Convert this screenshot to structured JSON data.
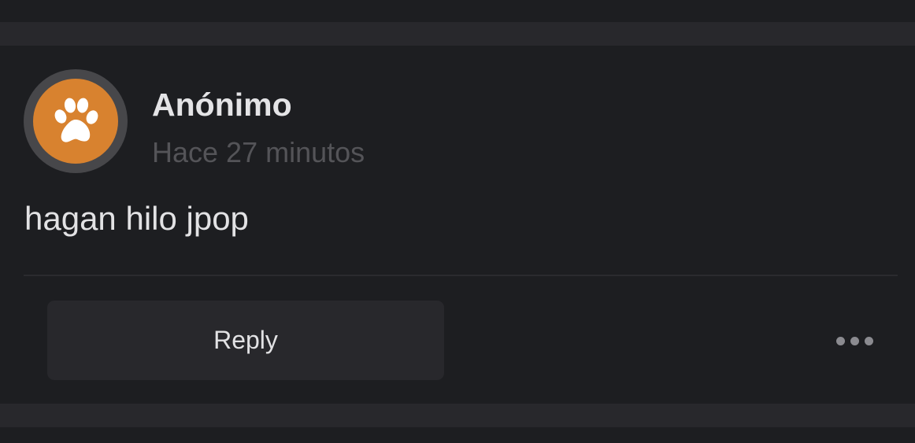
{
  "post": {
    "author": "Anónimo",
    "timestamp": "Hace 27 minutos",
    "body": "hagan hilo jpop",
    "avatar_icon": "paw-icon"
  },
  "actions": {
    "reply_label": "Reply",
    "more_icon": "more-horizontal-icon"
  },
  "colors": {
    "background": "#1d1e21",
    "separator": "#28282c",
    "avatar_ring": "#47474a",
    "avatar_fill": "#d8822f",
    "author_text": "#e4e4e6",
    "timestamp_text": "#545458",
    "button_bg": "#28282c"
  }
}
